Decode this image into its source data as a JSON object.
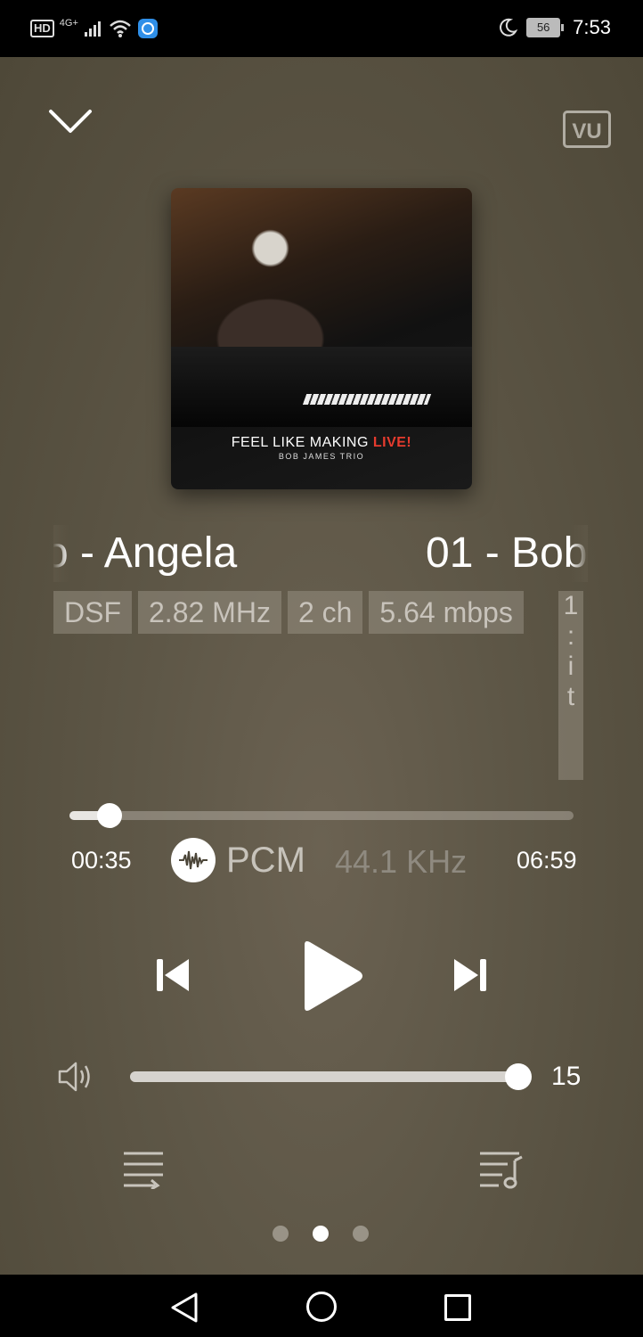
{
  "status_bar": {
    "hd": "HD",
    "network": "4G+",
    "battery": "56",
    "time": "7:53"
  },
  "header": {
    "vu_label": "VU"
  },
  "album": {
    "title_main": "FEEL LIKE MAKING",
    "title_accent": "LIVE!",
    "artist": "BOB JAMES TRIO"
  },
  "track": {
    "marquee_part1": "o - Angela",
    "marquee_part2": "01 - Bob"
  },
  "format_tags": [
    "DSF",
    "2.82 MHz",
    "2 ch",
    "5.64 mbps"
  ],
  "format_tag_vertical": [
    "1",
    ":",
    "i",
    "t"
  ],
  "playback": {
    "current_time": "00:35",
    "duration": "06:59",
    "progress": 0.08,
    "output_mode": "PCM",
    "output_rate": "44.1 KHz"
  },
  "volume": {
    "level": 15,
    "fraction": 1.0
  },
  "pager": {
    "count": 3,
    "active_index": 1
  }
}
